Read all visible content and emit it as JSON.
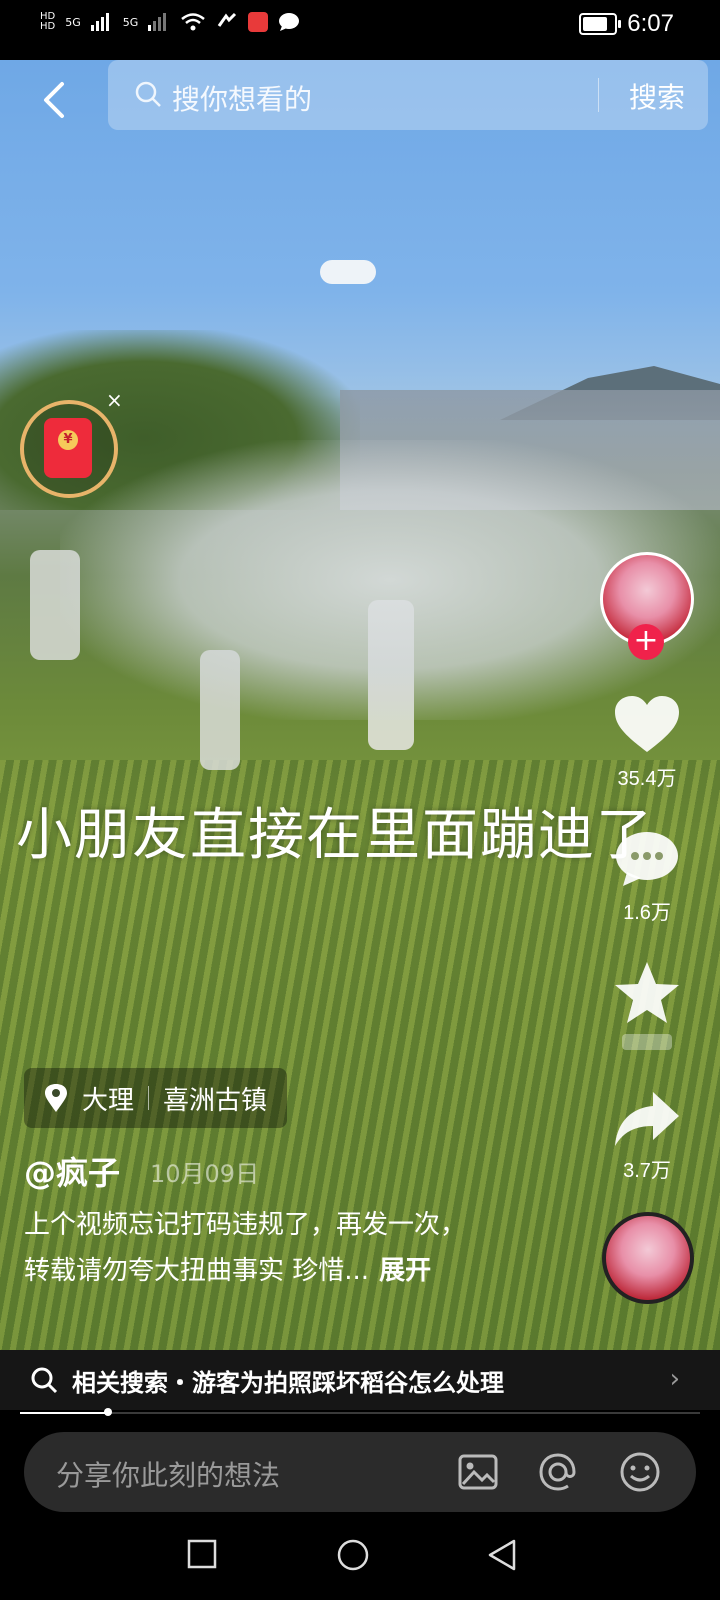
{
  "status_bar": {
    "time": "6:07",
    "signal_1": "5G",
    "signal_2": "5G",
    "battery": "battery-full"
  },
  "top_bar": {
    "search_placeholder": "搜你想看的",
    "search_button": "搜索"
  },
  "video": {
    "caption": "小朋友直接在里面蹦迪了"
  },
  "side_actions": {
    "likes": "35.4万",
    "comments": "1.6万",
    "shares": "3.7万"
  },
  "location": {
    "city": "大理",
    "place": "喜洲古镇"
  },
  "post": {
    "author": "@疯子",
    "date": "10月09日",
    "desc_line1": "上个视频忘记打码违规了，再发一次，",
    "desc_line2": "转载请勿夸大扭曲事实 珍惜...",
    "more": "展开"
  },
  "related_search": {
    "text": "相关搜索・游客为拍照踩坏稻谷怎么处理"
  },
  "progress": {
    "fraction": 0.13
  },
  "comment_bar": {
    "placeholder": "分享你此刻的想法"
  },
  "colors": {
    "accent": "#f0224b",
    "red_packet": "#ee2b3b"
  }
}
